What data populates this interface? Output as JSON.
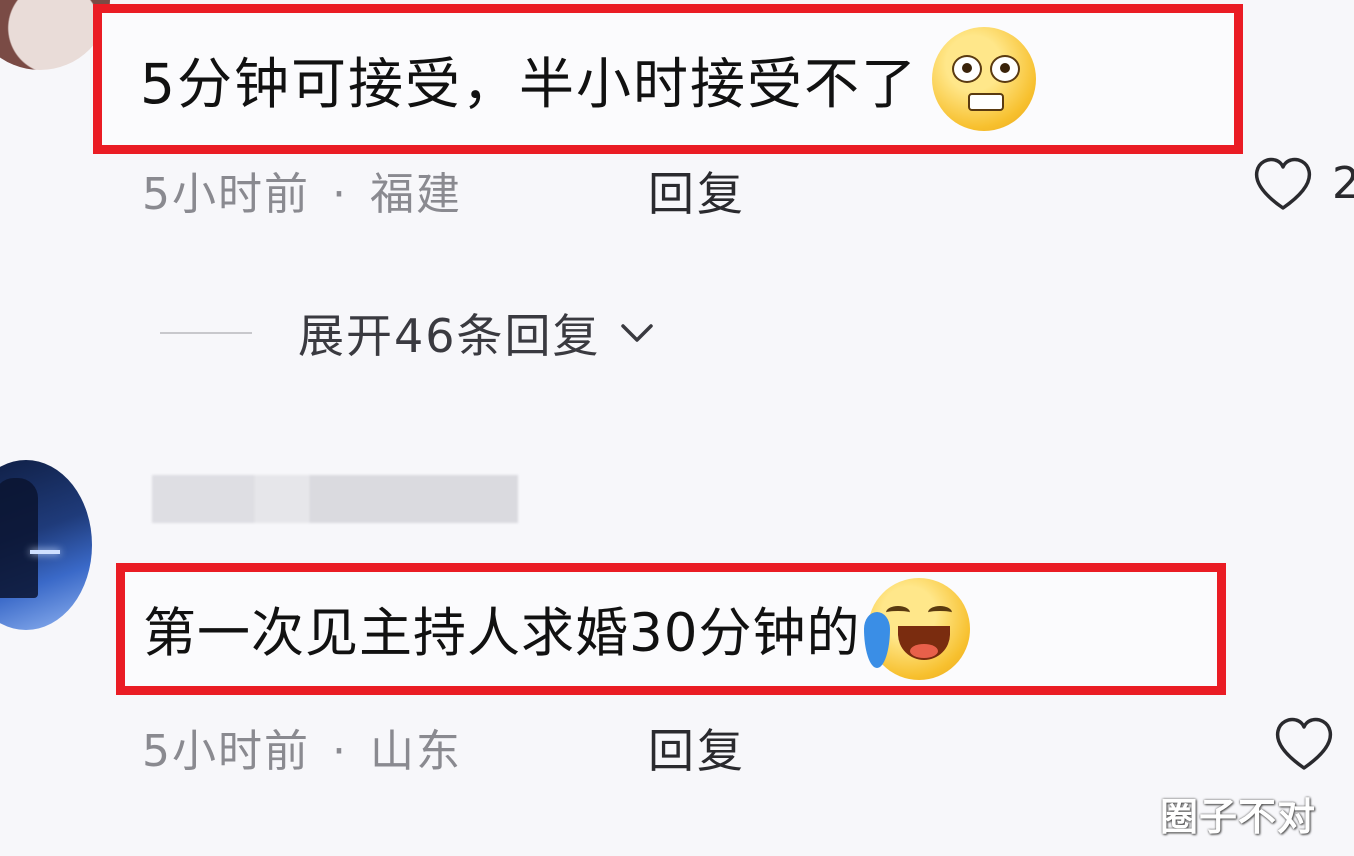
{
  "comments": [
    {
      "text": "5分钟可接受，半小时接受不了",
      "emoji": "nervous-face-emoji",
      "time": "5小时前",
      "separator": "·",
      "location": "福建",
      "reply_label": "回复",
      "like_count": "2"
    },
    {
      "text": "第一次见主持人求婚30分钟的",
      "emoji": "laughing-crying-face-emoji",
      "time": "5小时前",
      "separator": "·",
      "location": "山东",
      "reply_label": "回复",
      "like_count": ""
    }
  ],
  "expand_replies": {
    "label": "展开46条回复",
    "icon": "chevron-down-icon"
  },
  "watermark": "圈子不对",
  "colors": {
    "highlight_border": "#ea1c24",
    "meta_text": "#8a8a90",
    "background": "#f7f7fa"
  }
}
